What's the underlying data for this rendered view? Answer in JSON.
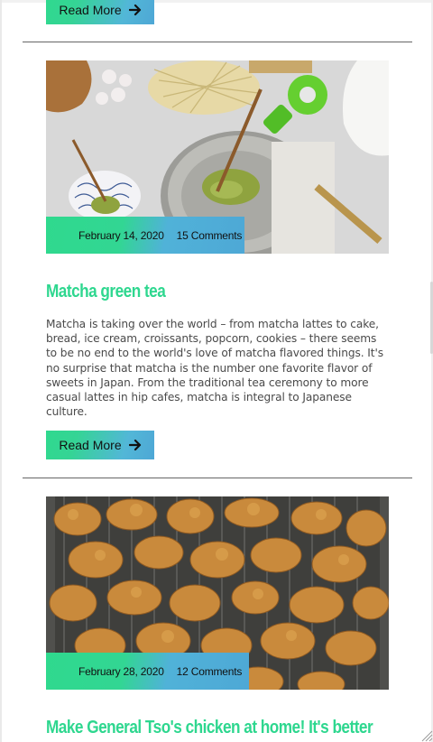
{
  "posts": [
    {
      "read_more": "Read More"
    },
    {
      "image_icon": "matcha-tea-photo",
      "date": "February 14, 2020",
      "comments": "15 Comments",
      "title": "Matcha green tea",
      "excerpt": "Matcha is taking over the world – from matcha lattes to cake, bread, ice cream, croissants, popcorn, cookies – there seems to be no end to the world's love of matcha flavored things. It's no surprise that matcha is the number one favorite flavor of sweets in Japan. From the traditional tea ceremony to more casual lattes in hip cafes, matcha is integral to Japanese culture.",
      "read_more": "Read More"
    },
    {
      "image_icon": "fried-chicken-photo",
      "date": "February 28, 2020",
      "comments": "12 Comments",
      "title": "Make General Tso's chicken at home! It's better"
    }
  ],
  "colors": {
    "accent_green": "#2ed78f",
    "accent_blue": "#4ea8d6"
  }
}
